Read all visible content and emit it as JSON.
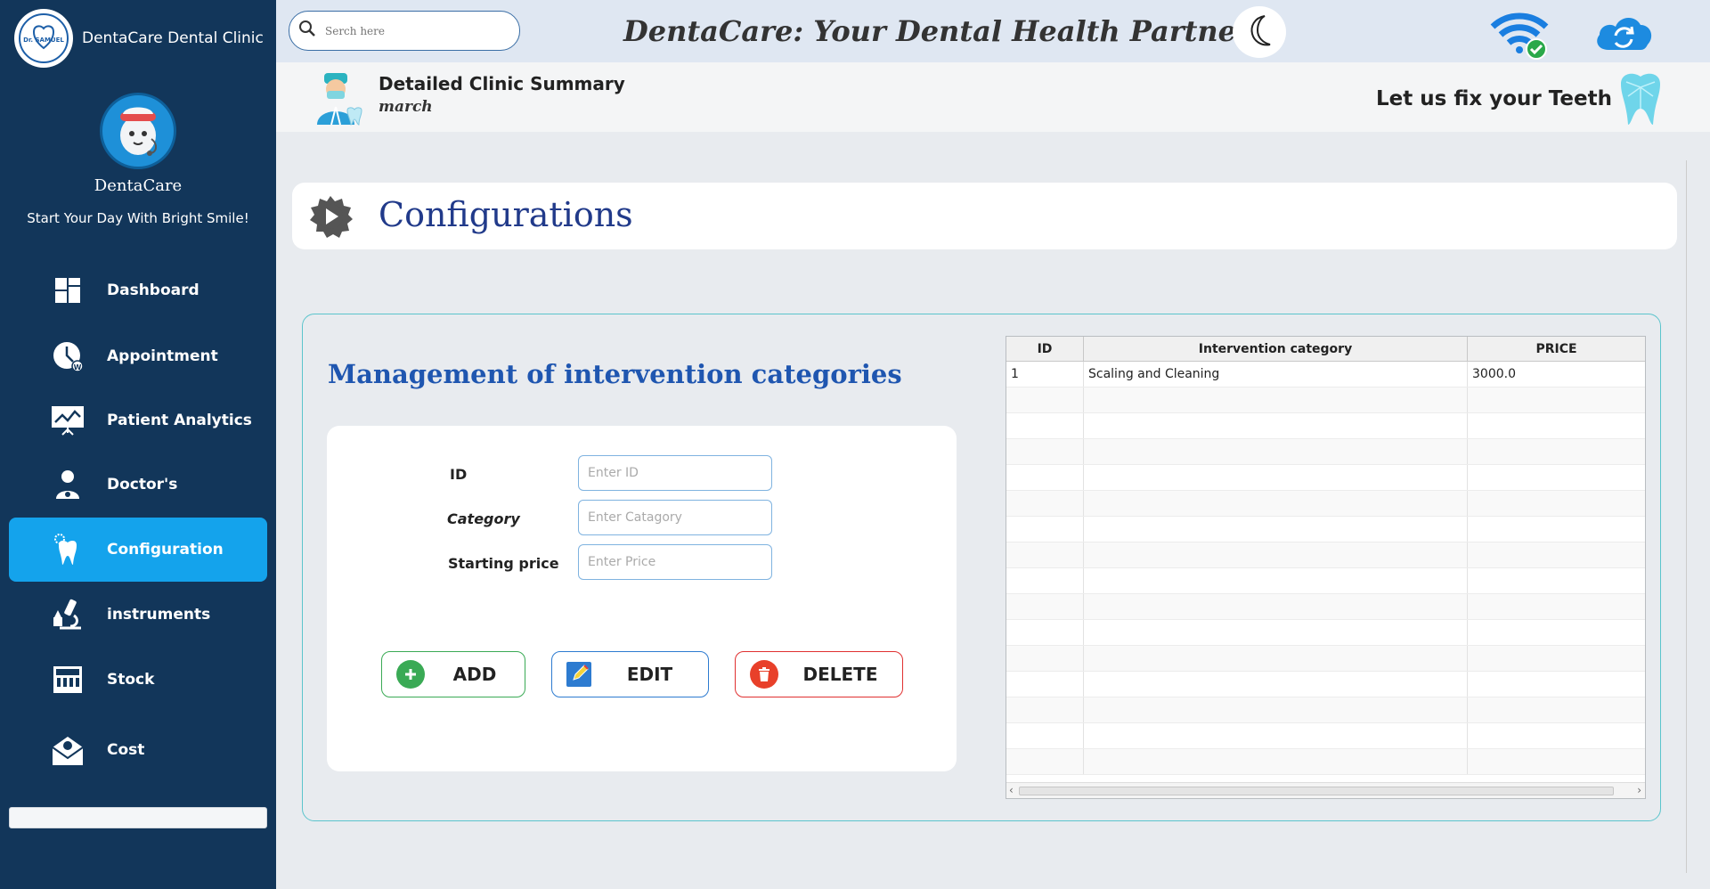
{
  "sidebar": {
    "brand_name": "DentaCare Dental Clinic",
    "logo_text": "Dr. SAMUEL",
    "profile_name": "DentaCare",
    "tagline": "Start Your Day With Bright Smile!",
    "active": "Configuration",
    "items": [
      {
        "label": "Dashboard",
        "icon": "dashboard-icon"
      },
      {
        "label": "Appointment",
        "icon": "clock-icon"
      },
      {
        "label": "Patient Analytics",
        "icon": "chart-board-icon"
      },
      {
        "label": "Doctor's",
        "icon": "doctor-icon"
      },
      {
        "label": "Configuration",
        "icon": "tooth-gear-icon"
      },
      {
        "label": "instruments",
        "icon": "microscope-icon"
      },
      {
        "label": "Stock",
        "icon": "store-icon"
      },
      {
        "label": "Cost",
        "icon": "envelope-person-icon"
      }
    ]
  },
  "header": {
    "search_placeholder": "Serch here",
    "title": "DentaCare: Your Dental Health Partner",
    "summary_title": "Detailed Clinic  Summary",
    "summary_month": "march",
    "motto": "Let us fix your Teeth"
  },
  "page": {
    "title": "Configurations",
    "panel_title": "Management of intervention categories",
    "form": {
      "id_label": "ID",
      "id_placeholder": "Enter ID",
      "category_label": "Category",
      "category_placeholder": "Enter Catagory",
      "price_label": "Starting price",
      "price_placeholder": "Enter Price"
    },
    "buttons": {
      "add": "ADD",
      "edit": "EDIT",
      "delete": "DELETE"
    },
    "table": {
      "columns": [
        "ID",
        "Intervention category",
        "PRICE"
      ],
      "rows": [
        [
          "1",
          "Scaling and Cleaning",
          "3000.0"
        ]
      ]
    }
  },
  "colors": {
    "sidebar_bg": "#12365a",
    "active_bg": "#14a3ec",
    "title_blue": "#213a8a",
    "add_green": "#3aaa55",
    "edit_blue": "#2d7bd0",
    "delete_red": "#e03030"
  }
}
